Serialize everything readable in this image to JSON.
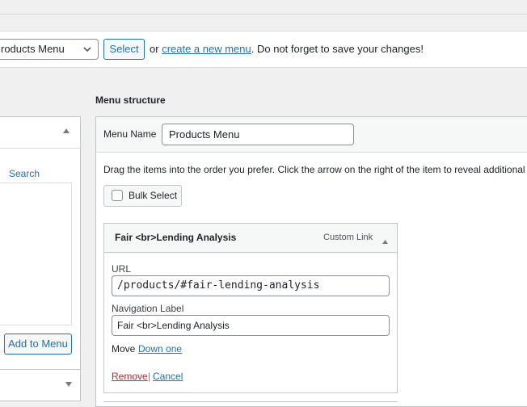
{
  "menu_select": {
    "selected": "roducts Menu"
  },
  "select_button": "Select",
  "hint": {
    "prefix": "or",
    "link": "create a new menu",
    "suffix": ". Do not forget to save your changes!"
  },
  "menu_structure_heading": "Menu structure",
  "left_panel": {
    "search_link": "Search",
    "add_button": "Add to Menu"
  },
  "menu_name": {
    "label": "Menu Name",
    "value": "Products Menu"
  },
  "instructions": "Drag the items into the order you prefer. Click the arrow on the right of the item to reveal additional confi",
  "bulk_select": "Bulk Select",
  "menu_item": {
    "title": "Fair <br>Lending Analysis",
    "type": "Custom Link",
    "url_label": "URL",
    "url_value": "/products/#fair-lending-analysis",
    "nav_label": "Navigation Label",
    "nav_value": "Fair <br>Lending Analysis",
    "move_label": "Move",
    "move_link": "Down one",
    "remove": "Remove",
    "separator": "|",
    "cancel": "Cancel"
  },
  "icons": {
    "collapse": "triangle-up-icon",
    "expand": "triangle-down-icon",
    "dropdown": "chevron-down-icon"
  }
}
